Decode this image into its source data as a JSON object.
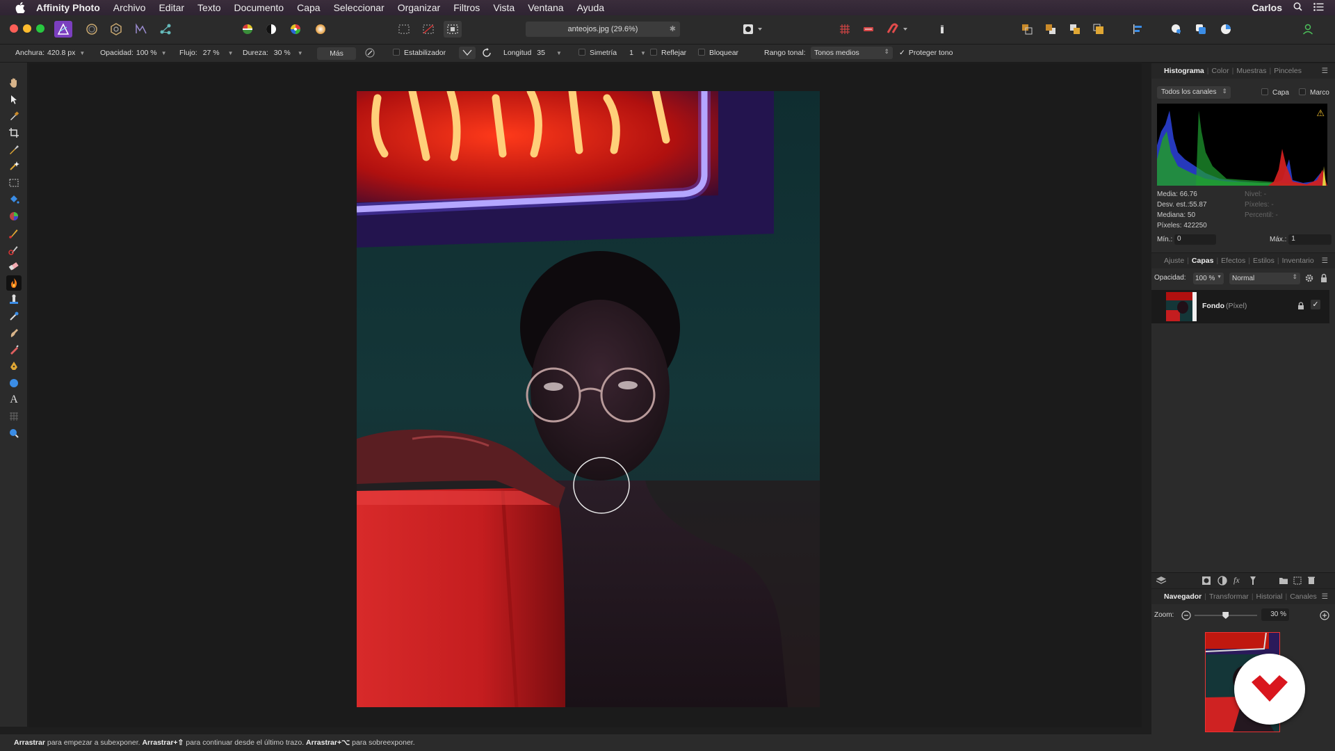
{
  "menubar": {
    "app": "Affinity Photo",
    "items": [
      "Archivo",
      "Editar",
      "Texto",
      "Documento",
      "Capa",
      "Seleccionar",
      "Organizar",
      "Filtros",
      "Vista",
      "Ventana",
      "Ayuda"
    ],
    "user": "Carlos"
  },
  "toolbar": {
    "document_title": "anteojos.jpg (29.6%)"
  },
  "context": {
    "anchura_label": "Anchura:",
    "anchura_value": "420.8 px",
    "opacidad_label": "Opacidad:",
    "opacidad_value": "100 %",
    "flujo_label": "Flujo:",
    "flujo_value": "27 %",
    "dureza_label": "Dureza:",
    "dureza_value": "30 %",
    "mas_label": "Más",
    "estabilizador_label": "Estabilizador",
    "longitud_label": "Longitud",
    "longitud_value": "35",
    "simetria_label": "Simetría",
    "simetria_value": "1",
    "reflejar_label": "Reflejar",
    "bloquear_label": "Bloquear",
    "rango_label": "Rango tonal:",
    "rango_value": "Tonos medios",
    "proteger_label": "Proteger tono"
  },
  "histogram_panel": {
    "tabs": [
      "Histograma",
      "Color",
      "Muestras",
      "Pinceles"
    ],
    "active_tab": "Histograma",
    "channel_select": "Todos los canales",
    "capa_label": "Capa",
    "marco_label": "Marco",
    "stats_left": [
      "Media: 66.76",
      "Desv. est.:55.87",
      "Mediana: 50",
      "Píxeles: 422250"
    ],
    "stats_right": [
      "Nivel: -",
      "Píxeles: -",
      "Percentil: -"
    ],
    "min_label": "Mín.:",
    "min_value": "0",
    "max_label": "Máx.:",
    "max_value": "1"
  },
  "layers_panel": {
    "tabs": [
      "Ajuste",
      "Capas",
      "Efectos",
      "Estilos",
      "Inventario"
    ],
    "active_tab": "Capas",
    "opacidad_label": "Opacidad:",
    "opacidad_value": "100 %",
    "blend_mode": "Normal",
    "layer_name": "Fondo",
    "layer_type": "(Píxel)"
  },
  "navigator_panel": {
    "tabs": [
      "Navegador",
      "Transformar",
      "Historial",
      "Canales"
    ],
    "active_tab": "Navegador",
    "zoom_label": "Zoom:",
    "zoom_value": "30 %",
    "zoom_level": 0.3
  },
  "status": {
    "part1_bold": "Arrastrar",
    "part1": " para empezar a subexponer. ",
    "part2_bold": "Arrastrar+⇧",
    "part2": " para continuar desde el último trazo. ",
    "part3_bold": "Arrastrar+⌥",
    "part3": " para sobreexponer."
  },
  "colors": {
    "accent_blue": "#1e6fdc",
    "panel_bg": "#2b2b2b",
    "canvas_bg": "#1b1b1b",
    "watermark_red": "#d9161e"
  }
}
